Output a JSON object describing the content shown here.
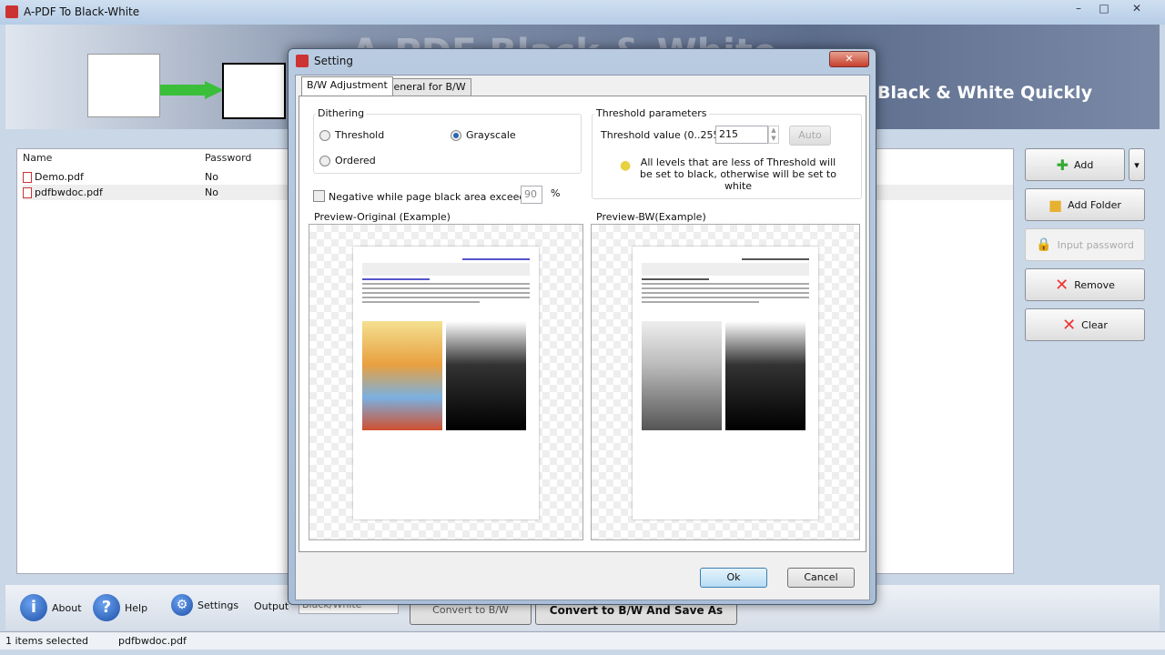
{
  "app": {
    "title": "A-PDF To Black-White",
    "banner_title": "A-PDF Black & White",
    "slogan": "Black & White Quickly"
  },
  "list": {
    "columns": [
      "Name",
      "Password"
    ],
    "rows": [
      {
        "name": "Demo.pdf",
        "password": "No"
      },
      {
        "name": "pdfbwdoc.pdf",
        "password": "No"
      }
    ]
  },
  "side_buttons": {
    "add": "Add",
    "add_folder": "Add Folder",
    "input_password": "Input password",
    "remove": "Remove",
    "clear": "Clear"
  },
  "toolbar": {
    "about": "About",
    "help": "Help",
    "settings": "Settings",
    "output": "Output",
    "output_value": "Black/White",
    "convert": "Convert to B/W",
    "convert_save": "Convert to B/W And Save As"
  },
  "status": {
    "selected": "1 items selected",
    "file": "pdfbwdoc.pdf"
  },
  "dialog": {
    "title": "Setting",
    "tabs": [
      "B/W Adjustment",
      "General for B/W"
    ],
    "dithering": {
      "label": "Dithering",
      "options": [
        "Threshold",
        "Grayscale",
        "Ordered"
      ],
      "selected": "Grayscale"
    },
    "negative": {
      "label": "Negative while page black area exceeds",
      "checked": false,
      "value": "90",
      "unit": "%"
    },
    "threshold": {
      "label": "Threshold parameters",
      "value_label": "Threshold value (0..255)",
      "value": "215",
      "auto": "Auto",
      "hint": "All levels that are less of Threshold will be set to black, otherwise will be set to white"
    },
    "preview_original": "Preview-Original (Example)",
    "preview_bw": "Preview-BW(Example)",
    "ok": "Ok",
    "cancel": "Cancel"
  },
  "colors": {
    "accent": "#2a66b8",
    "banner": "#5c6c8c"
  }
}
